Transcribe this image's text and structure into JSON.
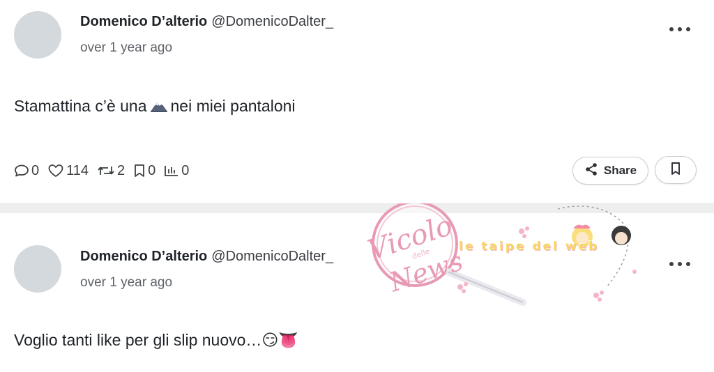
{
  "posts": [
    {
      "author": {
        "display_name": "Domenico D’alterio",
        "handle": "@DomenicoDalter_"
      },
      "timestamp": "over 1 year ago",
      "text_before": "Stamattina c’è una",
      "text_after": "nei miei pantaloni",
      "inline_icon": "mountain-emoji",
      "stats": {
        "replies": "0",
        "likes": "114",
        "reposts": "2",
        "bookmarks": "0",
        "views": "0"
      },
      "share_label": "Share"
    },
    {
      "author": {
        "display_name": "Domenico D’alterio",
        "handle": "@DomenicoDalter_"
      },
      "timestamp": "over 1 year ago",
      "text": "Voglio tanti like per gli slip nuovo…😏👅"
    }
  ],
  "watermark": {
    "vicolo": "Vicolo",
    "delle": "delle",
    "news": "News",
    "site": "le taipe del web"
  },
  "colors": {
    "avatar": "#d3d9dd",
    "divider": "#eeeeef",
    "watermark_pink": "#e89ab4",
    "watermark_yellow": "#f7d85e"
  }
}
